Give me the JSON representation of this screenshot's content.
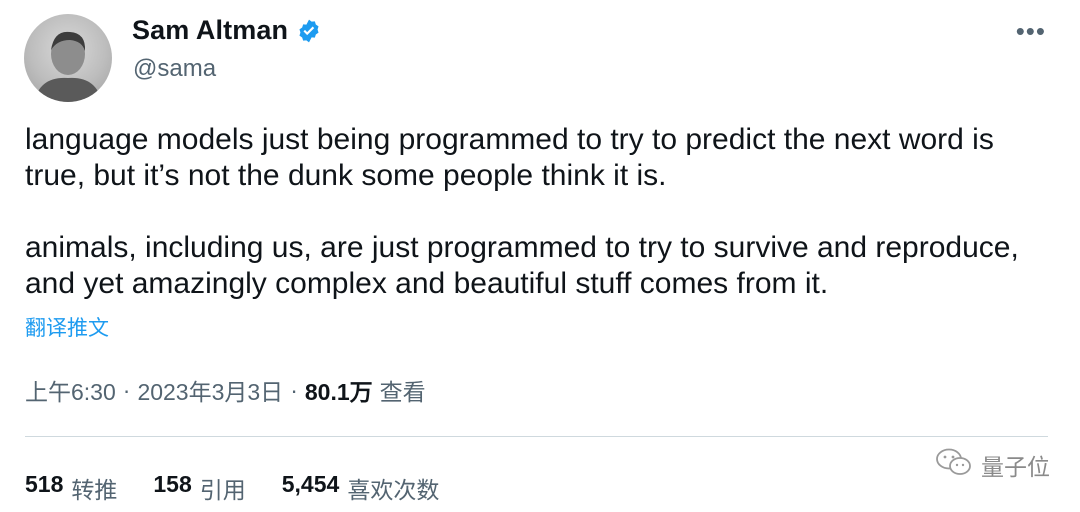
{
  "author": {
    "display_name": "Sam Altman",
    "handle": "@sama",
    "verified": true
  },
  "menu": {
    "more_icon": "more-horizontal-icon",
    "more_glyph": "•••"
  },
  "tweet": {
    "paragraphs": [
      "language models just being programmed to try to predict the next word is true, but it’s not the dunk some people think it is.",
      "animals, including us, are just programmed to try to survive and reproduce, and yet amazingly complex and beautiful stuff comes from it."
    ],
    "translate_label": "翻译推文"
  },
  "meta": {
    "time": "上午6:30",
    "sep": "·",
    "date": "2023年3月3日",
    "views_count": "80.1万",
    "views_label": "查看"
  },
  "stats": {
    "retweets": {
      "count": "518",
      "label": "转推"
    },
    "quotes": {
      "count": "158",
      "label": "引用"
    },
    "likes": {
      "count": "5,454",
      "label": "喜欢次数"
    }
  },
  "watermark": {
    "text": "量子位",
    "icon": "wechat-icon"
  },
  "colors": {
    "text": "#0f1419",
    "secondary": "#536471",
    "accent": "#1d9bf0",
    "divider": "#cfd9de"
  }
}
